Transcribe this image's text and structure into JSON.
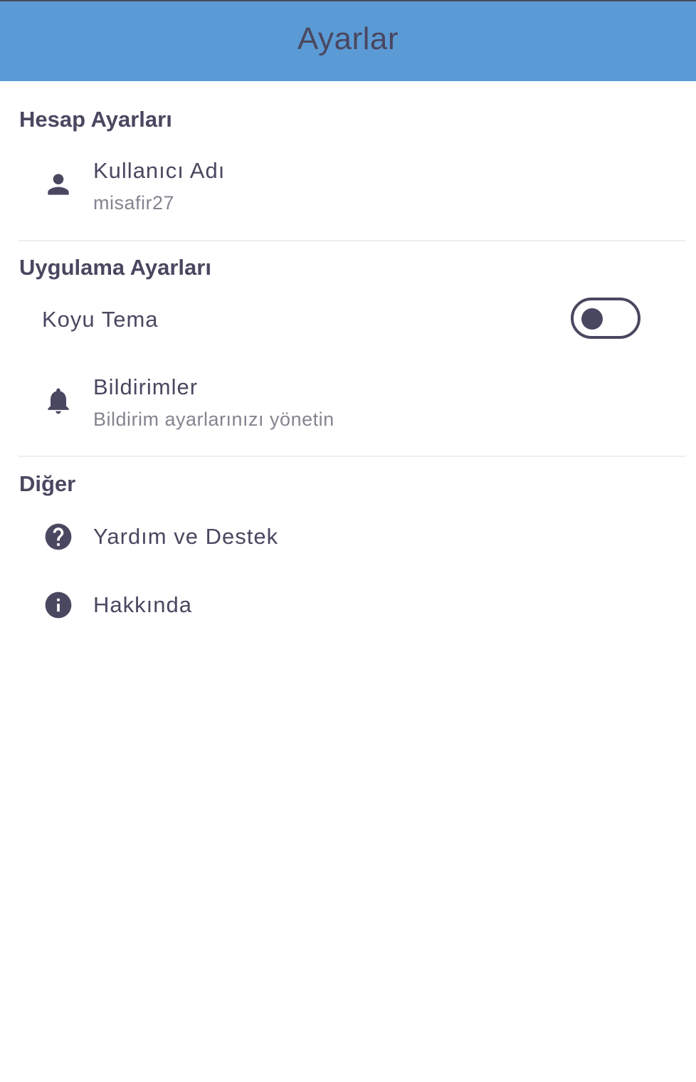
{
  "appbar": {
    "title": "Ayarlar"
  },
  "sections": {
    "account": {
      "header": "Hesap Ayarları",
      "username": {
        "icon": "person-icon",
        "title": "Kullanıcı Adı",
        "subtitle": "misafir27"
      }
    },
    "app": {
      "header": "Uygulama Ayarları",
      "dark_theme": {
        "label": "Koyu Tema",
        "enabled": false
      },
      "notifications": {
        "icon": "bell-icon",
        "title": "Bildirimler",
        "subtitle": "Bildirim ayarlarınızı yönetin"
      }
    },
    "other": {
      "header": "Diğer",
      "help": {
        "icon": "help-icon",
        "title": "Yardım ve Destek"
      },
      "about": {
        "icon": "info-icon",
        "title": "Hakkında"
      }
    }
  },
  "colors": {
    "appbar": "#5b9bd5",
    "text": "#4a4760",
    "subtitle": "#85838f",
    "divider": "#eeeeee"
  }
}
